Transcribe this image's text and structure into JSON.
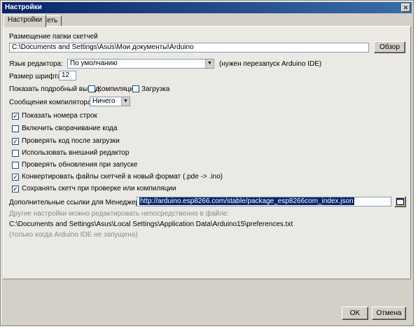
{
  "window": {
    "title": "Настройки",
    "close_glyph": "✕"
  },
  "tabs": [
    {
      "label": "Настройки"
    },
    {
      "label": "Сеть"
    }
  ],
  "sketchbook": {
    "label": "Размещение папки скетчей",
    "path": "C:\\Documents and Settings\\Asus\\Мои документы\\Arduino",
    "browse_label": "Обзор"
  },
  "editor_lang": {
    "label": "Язык редактора:",
    "value": "По умолчанию",
    "note": "(нужен перезапуск Arduino IDE)"
  },
  "font_size": {
    "label": "Размер шрифта:",
    "value": "12"
  },
  "verbose": {
    "label": "Показать подробный вывод:",
    "compile_label": "Компиляция",
    "upload_label": "Загрузка"
  },
  "compiler_warnings": {
    "label": "Сообщения компилятора:",
    "value": "Ничего"
  },
  "checkboxes": [
    {
      "label": "Показать номера строк",
      "checked": true
    },
    {
      "label": "Включить сворачивание кода",
      "checked": false
    },
    {
      "label": "Проверять код после загрузки",
      "checked": true
    },
    {
      "label": "Использовать внешний редактор",
      "checked": false
    },
    {
      "label": "Проверять обновления при запуске",
      "checked": false
    },
    {
      "label": "Конвертировать файлы скетчей в новый формат (.pde -> .ino)",
      "checked": true
    },
    {
      "label": "Сохранять скетч при проверке или компиляции",
      "checked": true
    }
  ],
  "board_urls": {
    "label": "Дополнительные ссылки для Менеджера плат:",
    "value": "http://arduino.esp8266.com/stable/package_esp8266com_index.json"
  },
  "prefs_info": {
    "hint": "Другие настройки можно редактировать непосредственно в файле:",
    "path": "C:\\Documents and Settings\\Asus\\Local Settings\\Application Data\\Arduino15\\preferences.txt",
    "note": "(только когда Arduino IDE не запущена)"
  },
  "buttons": {
    "ok_label": "OK",
    "cancel_label": "Отмена"
  }
}
